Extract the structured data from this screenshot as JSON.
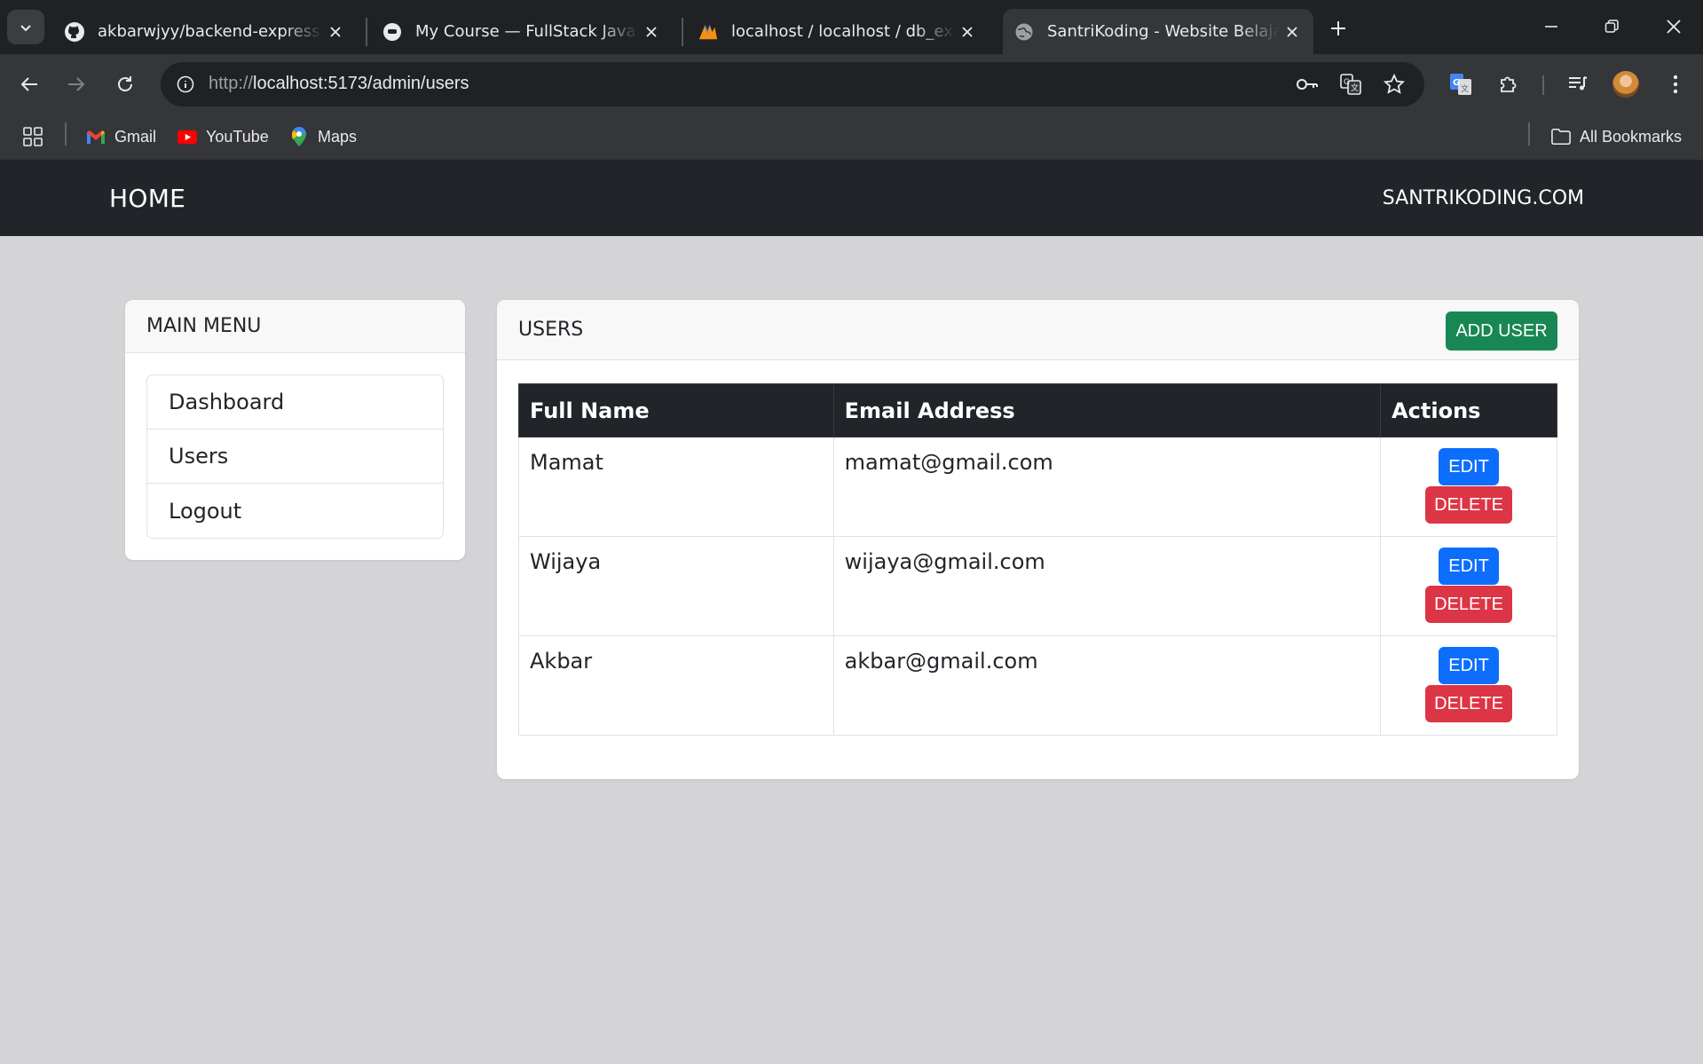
{
  "browser": {
    "tabs": [
      {
        "title": "akbarwjyy/backend-express",
        "icon": "github-icon"
      },
      {
        "title": "My Course — FullStack JavaScript",
        "icon": "course-icon"
      },
      {
        "title": "localhost / localhost / db_express",
        "icon": "phpmyadmin-icon"
      },
      {
        "title": "SantriKoding - Website Belajar Coding",
        "icon": "globe-icon",
        "active": true
      }
    ],
    "url_prefix": "http://",
    "url_host": "localhost",
    "url_rest": ":5173/admin/users",
    "bookmarks": [
      "Gmail",
      "YouTube",
      "Maps"
    ],
    "all_bookmarks": "All Bookmarks"
  },
  "navbar": {
    "brand": "HOME",
    "right_link": "SANTRIKODING.COM"
  },
  "sidebar": {
    "title": "MAIN MENU",
    "items": [
      "Dashboard",
      "Users",
      "Logout"
    ]
  },
  "users": {
    "title": "USERS",
    "add_label": "ADD USER",
    "columns": [
      "Full Name",
      "Email Address",
      "Actions"
    ],
    "edit_label": "EDIT",
    "delete_label": "DELETE",
    "rows": [
      {
        "name": "Mamat",
        "email": "mamat@gmail.com"
      },
      {
        "name": "Wijaya",
        "email": "wijaya@gmail.com"
      },
      {
        "name": "Akbar",
        "email": "akbar@gmail.com"
      }
    ]
  },
  "colors": {
    "navbar": "#212529",
    "success": "#198754",
    "primary": "#0d6efd",
    "danger": "#dc3545",
    "page_bg": "#d4d3d6"
  }
}
